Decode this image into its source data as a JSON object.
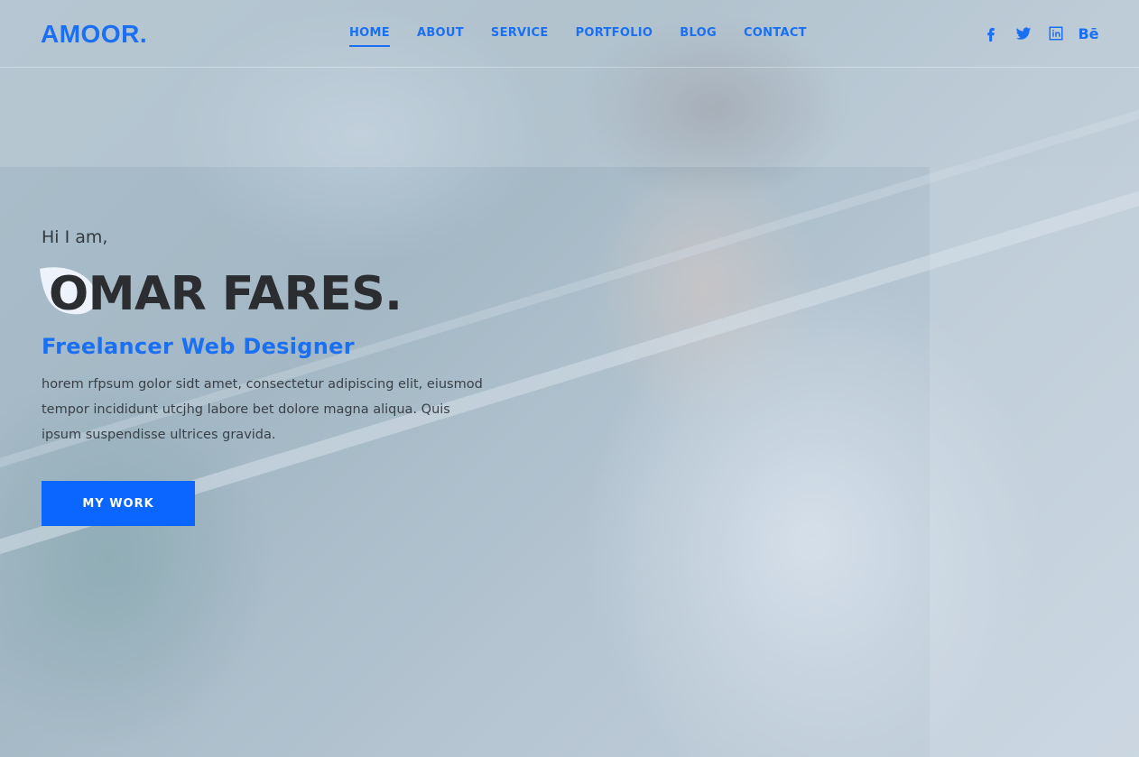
{
  "header": {
    "logo": "AMOOR.",
    "nav": [
      {
        "label": "HOME",
        "active": true
      },
      {
        "label": "ABOUT",
        "active": false
      },
      {
        "label": "SERVICE",
        "active": false
      },
      {
        "label": "PORTFOLIO",
        "active": false
      },
      {
        "label": "BLOG",
        "active": false
      },
      {
        "label": "CONTACT",
        "active": false
      }
    ],
    "social": [
      {
        "icon": "facebook-icon",
        "glyph": "f"
      },
      {
        "icon": "twitter-icon",
        "glyph": ""
      },
      {
        "icon": "linkedin-icon",
        "glyph": ""
      },
      {
        "icon": "behance-icon",
        "glyph": "Bē"
      }
    ]
  },
  "hero": {
    "greeting": "Hi I am,",
    "name": "OMAR FARES.",
    "role": "Freelancer Web Designer",
    "description": "horem rfpsum golor sidt amet, consectetur adipiscing elit, eiusmod tempor incididunt utcjhg labore bet dolore magna aliqua. Quis ipsum suspendisse ultrices gravida.",
    "button_label": "MY WORK"
  },
  "colors": {
    "accent": "#1a6ff3",
    "button": "#0a66ff",
    "heading": "#2b2d31"
  }
}
